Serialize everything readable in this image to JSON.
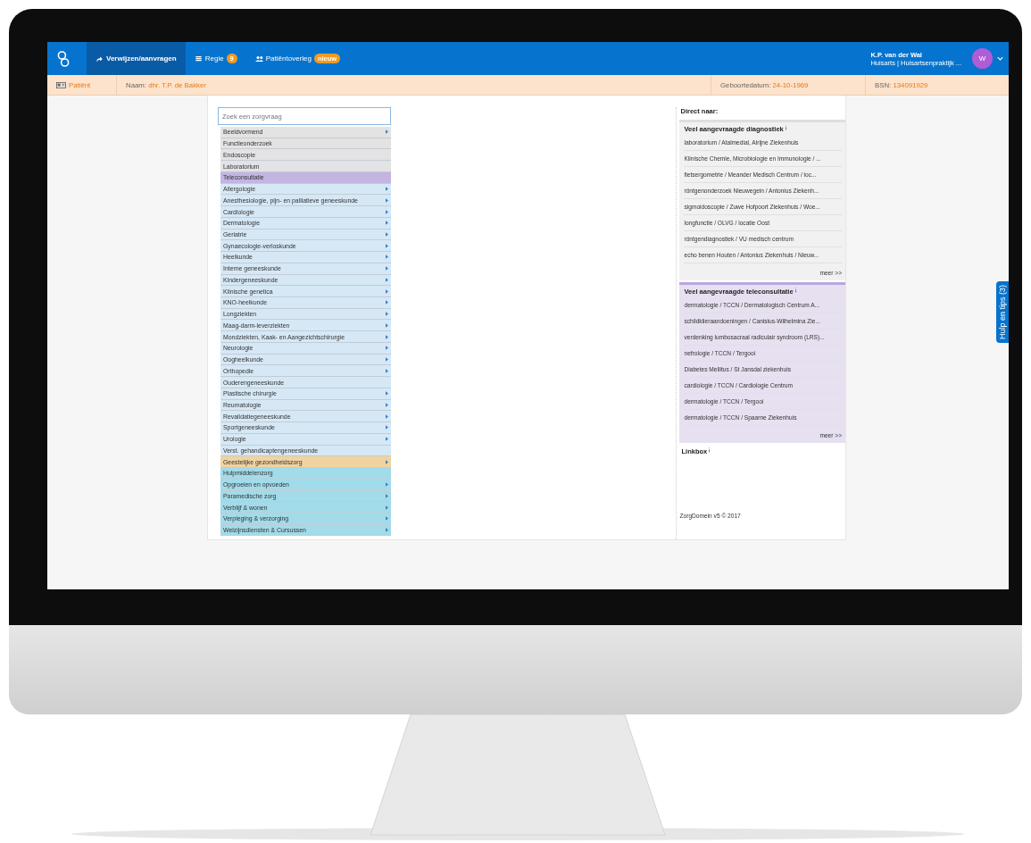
{
  "nav": {
    "tabs": [
      {
        "label": "Verwijzen/aanvragen",
        "selected": true
      },
      {
        "label": "Regie",
        "selected": false,
        "badge": "9"
      },
      {
        "label": "Patiëntoverleg",
        "selected": false,
        "badge": "nieuw"
      }
    ],
    "user": {
      "name": "K.P. van der Wal",
      "role": "Huisarts | Huisartsenpraktijk ...",
      "avatar": "W"
    }
  },
  "patient_bar": {
    "title": "Patiënt",
    "fields": [
      {
        "label": "Naam:",
        "value": "dhr. T.P. de Bakker"
      },
      {
        "label": "Geboortedatum:",
        "value": "24-10-1969"
      },
      {
        "label": "BSN:",
        "value": "134091929"
      }
    ]
  },
  "search": {
    "placeholder": "Zoek een zorgvraag"
  },
  "categories": [
    {
      "label": "Beeldvormend",
      "kind": "diagnostics",
      "submenu": true
    },
    {
      "label": "Functieonderzoek",
      "kind": "diagnostics",
      "submenu": false
    },
    {
      "label": "Endoscopie",
      "kind": "diagnostics",
      "submenu": false
    },
    {
      "label": "Laboratorium",
      "kind": "diagnostics",
      "submenu": false
    },
    {
      "label": "Teleconsultatie",
      "kind": "teleconsultation",
      "submenu": false
    },
    {
      "label": "Allergologie",
      "kind": "specialism",
      "submenu": true
    },
    {
      "label": "Anesthesiologie, pijn- en palliatieve geneeskunde",
      "kind": "specialism",
      "submenu": true
    },
    {
      "label": "Cardiologie",
      "kind": "specialism",
      "submenu": true
    },
    {
      "label": "Dermatologie",
      "kind": "specialism",
      "submenu": true
    },
    {
      "label": "Geriatrie",
      "kind": "specialism",
      "submenu": true
    },
    {
      "label": "Gynaecologie-verloskunde",
      "kind": "specialism",
      "submenu": true
    },
    {
      "label": "Heelkunde",
      "kind": "specialism",
      "submenu": true
    },
    {
      "label": "Interne geneeskunde",
      "kind": "specialism",
      "submenu": true
    },
    {
      "label": "Kindergeneeskunde",
      "kind": "specialism",
      "submenu": true
    },
    {
      "label": "Klinische genetica",
      "kind": "specialism",
      "submenu": true
    },
    {
      "label": "KNO-heelkunde",
      "kind": "specialism",
      "submenu": true
    },
    {
      "label": "Longziekten",
      "kind": "specialism",
      "submenu": true
    },
    {
      "label": "Maag-darm-leverziekten",
      "kind": "specialism",
      "submenu": true
    },
    {
      "label": "Mondziekten, Kaak- en Aangezichtschirurgie",
      "kind": "specialism",
      "submenu": true
    },
    {
      "label": "Neurologie",
      "kind": "specialism",
      "submenu": true
    },
    {
      "label": "Oogheelkunde",
      "kind": "specialism",
      "submenu": true
    },
    {
      "label": "Orthopedie",
      "kind": "specialism",
      "submenu": true
    },
    {
      "label": "Ouderengeneeskunde",
      "kind": "specialism",
      "submenu": false
    },
    {
      "label": "Plastische chirurgie",
      "kind": "specialism",
      "submenu": true
    },
    {
      "label": "Reumatologie",
      "kind": "specialism",
      "submenu": true
    },
    {
      "label": "Revalidatiegeneeskunde",
      "kind": "specialism",
      "submenu": true
    },
    {
      "label": "Sportgeneeskunde",
      "kind": "specialism",
      "submenu": true
    },
    {
      "label": "Urologie",
      "kind": "specialism",
      "submenu": true
    },
    {
      "label": "Verst. gehandicaptengeneeskunde",
      "kind": "specialism",
      "submenu": false
    },
    {
      "label": "Geestelijke gezondheidszorg",
      "kind": "mental_health",
      "submenu": true
    },
    {
      "label": "Hulpmiddelenzorg",
      "kind": "care",
      "submenu": false
    },
    {
      "label": "Opgroeien en opvoeden",
      "kind": "care",
      "submenu": true
    },
    {
      "label": "Paramedische zorg",
      "kind": "care",
      "submenu": true
    },
    {
      "label": "Verblijf & wonen",
      "kind": "care",
      "submenu": true
    },
    {
      "label": "Verpleging & verzorging",
      "kind": "care",
      "submenu": true
    },
    {
      "label": "Welzijnsdiensten & Cursussen",
      "kind": "care",
      "submenu": true
    }
  ],
  "direct": {
    "title": "Direct naar:",
    "sections": [
      {
        "title": "Veel aangevraagde diagnostiek",
        "kind": "diagnostics",
        "more": "meer >>",
        "links": [
          "laboratorium / Atalmedial, Alrijne Ziekenhuis",
          "Klinische Chemie, Microbiologie en Immunologie / ...",
          "fietsergometrie / Meander Medisch Centrum / loc...",
          "röntgenonderzoek Nieuwegein / Antonius Ziekenh...",
          "sigmoidoscopie / Zuwe Hofpoort Ziekenhuis / Woe...",
          "longfunctie / OLVG / locatie Oost",
          "röntgendiagnostiek / VU medisch centrum",
          "echo benen Houten / Antonius Ziekenhuis / Nieuw..."
        ]
      },
      {
        "title": "Veel aangevraagde teleconsultatie",
        "kind": "teleconsultation",
        "more": "meer >>",
        "links": [
          "dermatologie / TCCN / Dermatologisch Centrum A...",
          "schildklieraandoeningen / Canisius-Wilhelmina Zie...",
          "verdenking lumbosacraal radiculair syndroom (LRS)...",
          "nefrologie / TCCN / Tergooi",
          "Diabetes Mellitus / St Jansdal ziekenhuis",
          "cardiologie / TCCN / Cardiologie Centrum",
          "dermatologie / TCCN / Tergooi",
          "dermatologie / TCCN / Spaarne Ziekenhuis"
        ]
      }
    ],
    "linkbox": "Linkbox"
  },
  "footer": "ZorgDomein v5 © 2017",
  "help_tab": "Hulp en tips (3)"
}
